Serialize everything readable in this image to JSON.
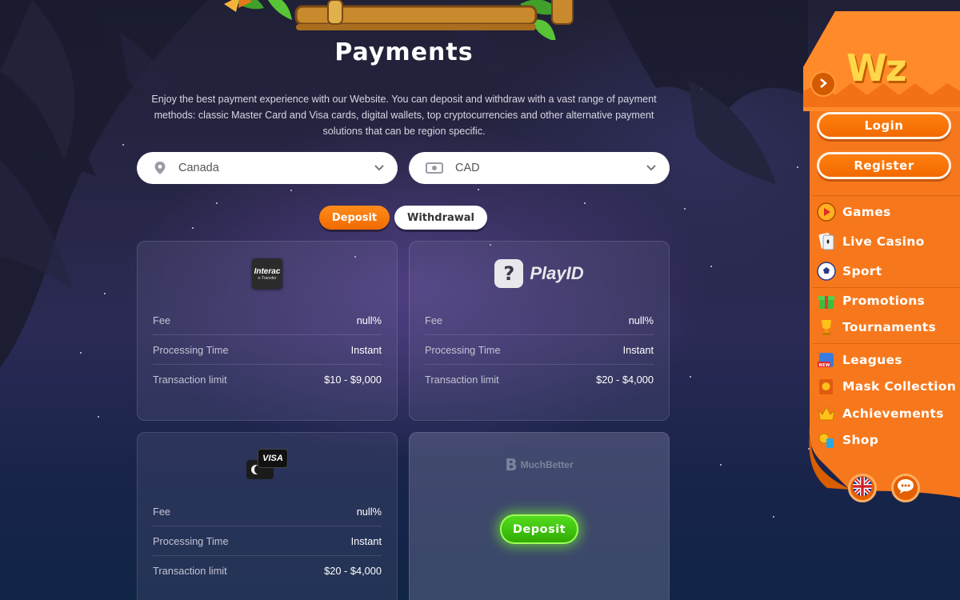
{
  "page": {
    "title": "Payments",
    "intro": "Enjoy the best payment experience with our Website. You can deposit and withdraw with a vast range of payment methods: classic Master Card and Visa cards, digital wallets, top cryptocurrencies and other alternative payment solutions that can be region specific."
  },
  "filters": {
    "country": {
      "value": "Canada",
      "icon": "location-pin-icon"
    },
    "currency": {
      "value": "CAD",
      "icon": "cash-icon"
    }
  },
  "tabs": [
    {
      "label": "Deposit",
      "active": true
    },
    {
      "label": "Withdrawal",
      "active": false
    }
  ],
  "labels": {
    "fee": "Fee",
    "processing": "Processing Time",
    "limit": "Transaction limit"
  },
  "methods": [
    {
      "logo_text": "Interac",
      "logo_sub": "e-Transfer",
      "fee": "null%",
      "processing": "Instant",
      "limit": "$10 - $9,000"
    },
    {
      "logo_text": "PlayID",
      "fee": "null%",
      "processing": "Instant",
      "limit": "$20 - $4,000"
    },
    {
      "logo_text": "VISA",
      "fee": "null%",
      "processing": "Instant",
      "limit": "$20 - $4,000"
    },
    {
      "logo_text": "MuchBetter",
      "cta": "Deposit"
    }
  ],
  "sidebar": {
    "brand": "Wz",
    "login": "Login",
    "register": "Register",
    "menu": [
      {
        "label": "Games",
        "icon": "games-icon"
      },
      {
        "label": "Live Casino",
        "icon": "cards-icon"
      },
      {
        "label": "Sport",
        "icon": "soccer-ball-icon"
      },
      {
        "label": "Promotions",
        "icon": "gift-icon"
      },
      {
        "label": "Tournaments",
        "icon": "trophy-icon"
      },
      {
        "label": "Leagues",
        "icon": "leagues-icon",
        "badge": "NEW"
      },
      {
        "label": "Mask Collection",
        "icon": "mask-icon"
      },
      {
        "label": "Achievements",
        "icon": "crown-icon"
      },
      {
        "label": "Shop",
        "icon": "shop-icon"
      }
    ],
    "language_icon": "uk-flag-icon",
    "chat_icon": "chat-icon"
  },
  "colors": {
    "accent_orange": "#f26a00",
    "cta_green": "#3fc00a",
    "background": "#262544"
  }
}
